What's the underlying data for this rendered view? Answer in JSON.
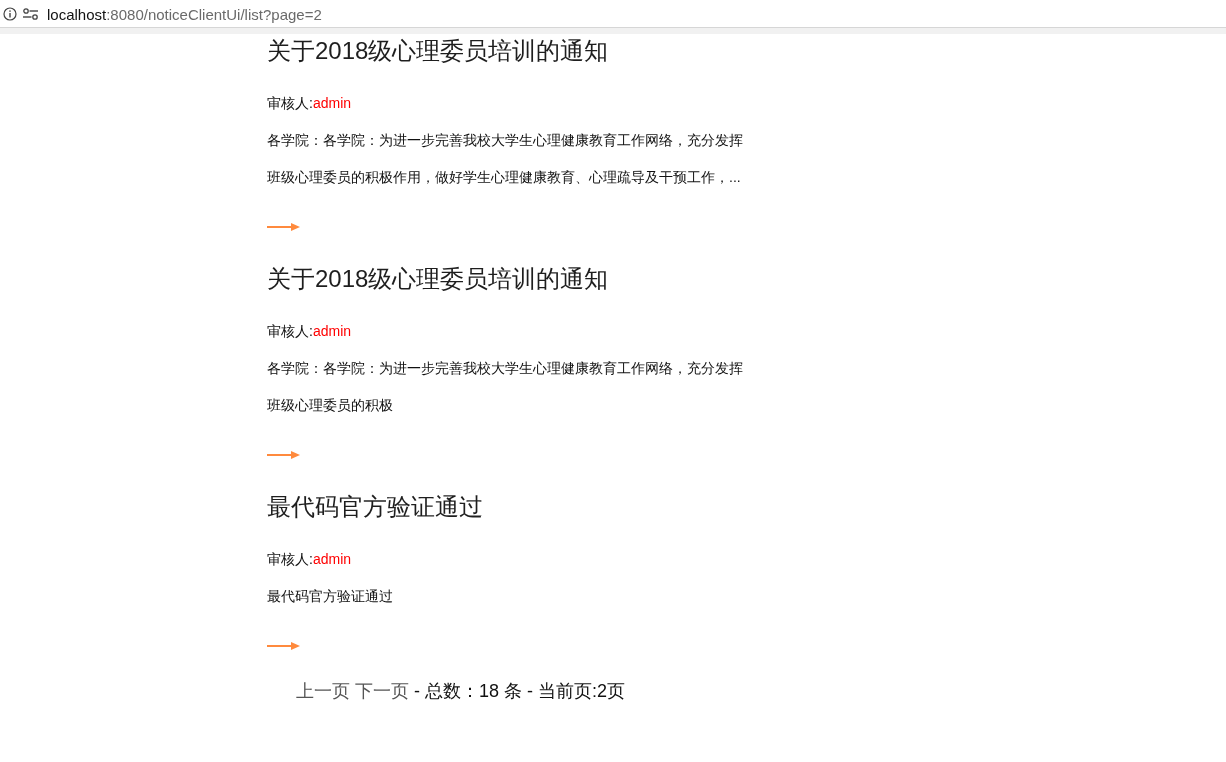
{
  "address_bar": {
    "host": "localhost",
    "path": ":8080/noticeClientUi/list?page=2"
  },
  "notices": [
    {
      "title": "关于2018级心理委员培训的通知",
      "reviewer_label": "审核人:",
      "reviewer": "admin",
      "paragraphs": [
        "各学院：各学院：为进一步完善我校大学生心理健康教育工作网络，充分发挥",
        "班级心理委员的积极作用，做好学生心理健康教育、心理疏导及干预工作，..."
      ]
    },
    {
      "title": "关于2018级心理委员培训的通知",
      "reviewer_label": "审核人:",
      "reviewer": "admin",
      "paragraphs": [
        "各学院：各学院：为进一步完善我校大学生心理健康教育工作网络，充分发挥",
        "班级心理委员的积极"
      ]
    },
    {
      "title": "最代码官方验证通过",
      "reviewer_label": "审核人:",
      "reviewer": "admin",
      "paragraphs": [
        "最代码官方验证通过"
      ]
    }
  ],
  "pager": {
    "prev": "上一页",
    "next": "下一页",
    "summary": "- 总数：18 条 - 当前页:2页"
  }
}
